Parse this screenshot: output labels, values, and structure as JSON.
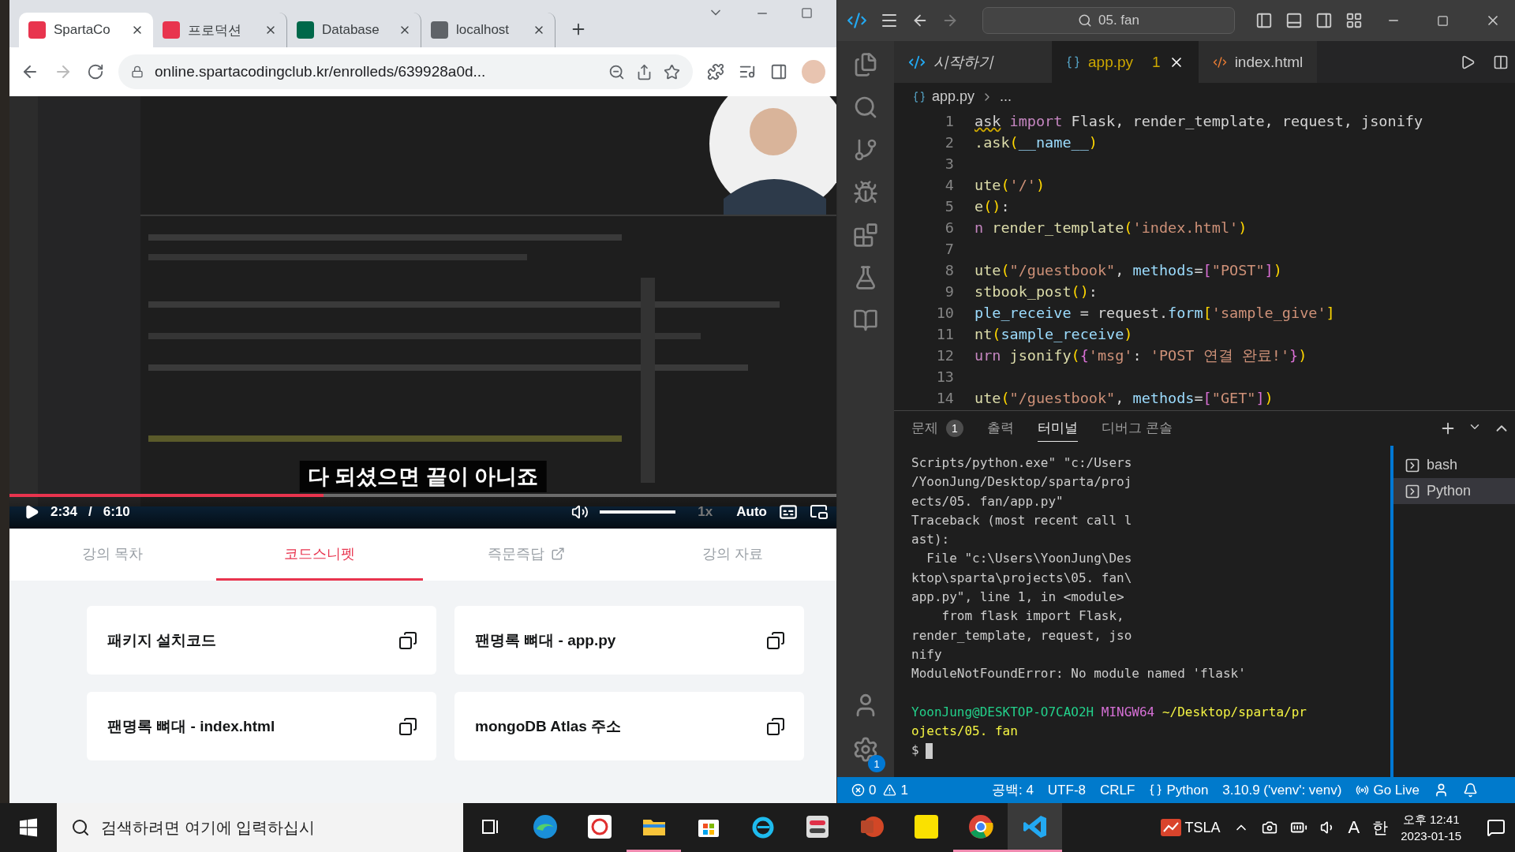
{
  "browser": {
    "tabs": [
      {
        "title": "SpartaCo",
        "kind": "sparta",
        "selected": true
      },
      {
        "title": "프로덕션",
        "kind": "production",
        "selected": false
      },
      {
        "title": "Database",
        "kind": "mongo",
        "selected": false
      },
      {
        "title": "localhost",
        "kind": "globe",
        "selected": false
      }
    ],
    "url": "online.spartacodingclub.kr/enrolleds/639928a0d..."
  },
  "video": {
    "kind": "picture",
    "subtitle": "다 되셨으면 끝이 아니죠",
    "progress": {
      "level": 0.38
    },
    "current_time": "2:34",
    "separator": "/",
    "duration": "6:10",
    "volume": {
      "level": 1
    },
    "speed": "1x",
    "quality": "Auto"
  },
  "lecture_tabs": [
    {
      "label": "강의 목차",
      "selected": false,
      "external": false
    },
    {
      "label": "코드스니펫",
      "selected": true,
      "external": false
    },
    {
      "label": "즉문즉답",
      "selected": false,
      "external": true
    },
    {
      "label": "강의 자료",
      "selected": false,
      "external": false
    }
  ],
  "snippets": [
    "패키지 설치코드",
    "팬명록 뼈대 - app.py",
    "팬명록 뼈대 - index.html",
    "mongoDB Atlas 주소"
  ],
  "vscode": {
    "search": "05. fan",
    "tabs": [
      {
        "label": "시작하기",
        "kind": "welcome",
        "selected": false
      },
      {
        "label": "app.py",
        "kind": "python",
        "selected": true,
        "problems": "1"
      },
      {
        "label": "index.html",
        "kind": "html",
        "selected": false
      }
    ],
    "breadcrumb": [
      "app.py",
      "..."
    ],
    "code": [
      {
        "number": "1",
        "tokens": [
          {
            "text": "ask",
            "kind": "warn"
          },
          {
            "text": " import",
            "kind": "keyword"
          },
          {
            "text": " Flask, render_template, request, jsonify",
            "kind": "plain"
          }
        ]
      },
      {
        "number": "2",
        "tokens": [
          {
            "text": ".ask",
            "kind": "fn"
          },
          {
            "text": "(",
            "kind": "bracket"
          },
          {
            "text": "__name__",
            "kind": "var"
          },
          {
            "text": ")",
            "kind": "bracket"
          }
        ]
      },
      {
        "number": "3"
      },
      {
        "number": "4",
        "tokens": [
          {
            "text": "ute",
            "kind": "fn"
          },
          {
            "text": "(",
            "kind": "bracket"
          },
          {
            "text": "'/'",
            "kind": "str"
          },
          {
            "text": ")",
            "kind": "bracket"
          }
        ]
      },
      {
        "number": "5",
        "tokens": [
          {
            "text": "e",
            "kind": "fn"
          },
          {
            "text": "()",
            "kind": "bracket"
          },
          {
            "text": ":",
            "kind": "plain"
          }
        ]
      },
      {
        "number": "6",
        "tokens": [
          {
            "text": "n",
            "kind": "keyword"
          },
          {
            "text": " render_template",
            "kind": "fn"
          },
          {
            "text": "(",
            "kind": "bracket"
          },
          {
            "text": "'index.html'",
            "kind": "str"
          },
          {
            "text": ")",
            "kind": "bracket"
          }
        ]
      },
      {
        "number": "7"
      },
      {
        "number": "8",
        "tokens": [
          {
            "text": "ute",
            "kind": "fn"
          },
          {
            "text": "(",
            "kind": "bracket"
          },
          {
            "text": "\"/guestbook\"",
            "kind": "str"
          },
          {
            "text": ", ",
            "kind": "plain"
          },
          {
            "text": "methods",
            "kind": "var"
          },
          {
            "text": "=",
            "kind": "plain"
          },
          {
            "text": "[",
            "kind": "bracket2"
          },
          {
            "text": "\"POST\"",
            "kind": "str"
          },
          {
            "text": "]",
            "kind": "bracket2"
          },
          {
            "text": ")",
            "kind": "bracket"
          }
        ]
      },
      {
        "number": "9",
        "tokens": [
          {
            "text": "stbook_post",
            "kind": "fn"
          },
          {
            "text": "()",
            "kind": "bracket"
          },
          {
            "text": ":",
            "kind": "plain"
          }
        ]
      },
      {
        "number": "10",
        "tokens": [
          {
            "text": "ple_receive",
            "kind": "var"
          },
          {
            "text": " = request.",
            "kind": "plain"
          },
          {
            "text": "form",
            "kind": "var"
          },
          {
            "text": "[",
            "kind": "bracket"
          },
          {
            "text": "'sample_give'",
            "kind": "str"
          },
          {
            "text": "]",
            "kind": "bracket"
          }
        ]
      },
      {
        "number": "11",
        "tokens": [
          {
            "text": "nt",
            "kind": "fn"
          },
          {
            "text": "(",
            "kind": "bracket"
          },
          {
            "text": "sample_receive",
            "kind": "var"
          },
          {
            "text": ")",
            "kind": "bracket"
          }
        ]
      },
      {
        "number": "12",
        "tokens": [
          {
            "text": "urn",
            "kind": "keyword"
          },
          {
            "text": " jsonify",
            "kind": "fn"
          },
          {
            "text": "(",
            "kind": "bracket"
          },
          {
            "text": "{",
            "kind": "bracket2"
          },
          {
            "text": "'msg'",
            "kind": "str"
          },
          {
            "text": ": ",
            "kind": "plain"
          },
          {
            "text": "'POST 연결 완료!'",
            "kind": "str"
          },
          {
            "text": "}",
            "kind": "bracket2"
          },
          {
            "text": ")",
            "kind": "bracket"
          }
        ]
      },
      {
        "number": "13"
      },
      {
        "number": "14",
        "tokens": [
          {
            "text": "ute",
            "kind": "fn"
          },
          {
            "text": "(",
            "kind": "bracket"
          },
          {
            "text": "\"/guestbook\"",
            "kind": "str"
          },
          {
            "text": ", ",
            "kind": "plain"
          },
          {
            "text": "methods",
            "kind": "var"
          },
          {
            "text": "=",
            "kind": "plain"
          },
          {
            "text": "[",
            "kind": "bracket2"
          },
          {
            "text": "\"GET\"",
            "kind": "str"
          },
          {
            "text": "]",
            "kind": "bracket2"
          },
          {
            "text": ")",
            "kind": "bracket"
          }
        ]
      }
    ],
    "panel_tabs": [
      {
        "label": "문제",
        "selected": false,
        "badge": "1"
      },
      {
        "label": "출력",
        "selected": false
      },
      {
        "label": "터미널",
        "selected": true
      },
      {
        "label": "디버그 콘솔",
        "selected": false
      }
    ],
    "terminal_lines": [
      "Scripts/python.exe\" \"c:/Users",
      "/YoonJung/Desktop/sparta/proj",
      "ects/05. fan/app.py\"",
      "Traceback (most recent call l",
      "ast):",
      "  File \"c:\\Users\\YoonJung\\Des",
      "ktop\\sparta\\projects\\05. fan\\",
      "app.py\", line 1, in <module>",
      "    from flask import Flask,",
      "render_template, request, jso",
      "nify",
      "ModuleNotFoundError: No module named 'flask'"
    ],
    "prompt_lines": [
      [
        {
          "text": "YoonJung@DESKTOP-O7CAO2H",
          "kind": "user"
        },
        {
          "text": " MINGW64",
          "kind": "host"
        },
        {
          "text": " ~/Desktop/sparta/pr",
          "kind": "path"
        }
      ],
      [
        {
          "text": "ojects/05. fan",
          "kind": "path"
        }
      ]
    ],
    "prompt_symbol": "$",
    "terminals": [
      {
        "label": "bash",
        "selected": false
      },
      {
        "label": "Python",
        "selected": true
      }
    ],
    "settings_badge": "1",
    "status_bar": {
      "errors": "0",
      "warnings": "1",
      "items": [
        "공백: 4",
        "UTF-8",
        "CRLF"
      ],
      "language": "Python",
      "interpreter": "3.10.9 ('venv': venv)",
      "live": "Go Live"
    }
  },
  "taskbar": {
    "search": {
      "placeholder": "검색하려면 여기에 입력하십시"
    },
    "apps": [
      {
        "kind": "task-view",
        "running": false,
        "selected": false
      },
      {
        "kind": "edge",
        "running": false,
        "selected": false
      },
      {
        "kind": "sync",
        "running": false,
        "selected": false
      },
      {
        "kind": "folder",
        "running": true,
        "selected": false
      },
      {
        "kind": "store",
        "running": false,
        "selected": false
      },
      {
        "kind": "ie",
        "running": false,
        "selected": false
      },
      {
        "kind": "toggle",
        "running": false,
        "selected": false
      },
      {
        "kind": "powerpoint",
        "running": false,
        "selected": false
      },
      {
        "kind": "talk",
        "running": false,
        "selected": false
      },
      {
        "kind": "chrome",
        "running": true,
        "selected": false
      },
      {
        "kind": "vscode",
        "running": true,
        "selected": true
      }
    ],
    "stock": "TSLA",
    "ime_mode": "A",
    "ime_lang": "한",
    "time": "오후 12:41",
    "date": "2023-01-15"
  }
}
